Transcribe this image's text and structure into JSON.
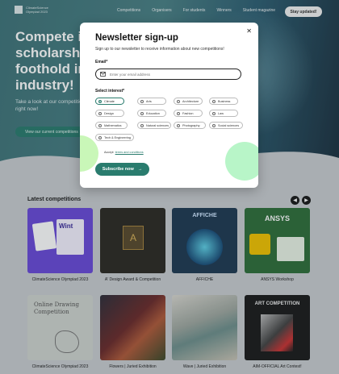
{
  "nav": {
    "logo_text": "ClimateScience Olympiad 2023",
    "links": [
      "Competitions",
      "Organisers",
      "For students",
      "Winners",
      "Student magazine"
    ],
    "stay_label": "Stay updated!"
  },
  "hero": {
    "title": "Compete in scholarships foothold in industry!",
    "subtitle": "Take a look at our competitions available right now!",
    "cta": "View our current competitions"
  },
  "competitions": {
    "heading": "Latest competitions",
    "cards": [
      {
        "title": "ClimateScience Olympiad 2023",
        "poster": "Wint",
        "color": "#6a4ad8"
      },
      {
        "title": "A' Design Award & Competition",
        "poster": "A",
        "color": "#2d2a24"
      },
      {
        "title": "AFFICHE",
        "poster": "AFFICHE",
        "color": "#1f3a52"
      },
      {
        "title": "ANSYS Workshop",
        "poster": "ANSYS",
        "color": "#2f6e3a"
      },
      {
        "title": "ClimateScience Olympiad 2023",
        "poster": "Online Drawing Competition",
        "color": "#cfd3cf"
      },
      {
        "title": "Flowers | Juried Exhibition",
        "poster": "",
        "color": "#4a3c3c"
      },
      {
        "title": "Wave | Juried Exhibition",
        "poster": "",
        "color": "#b7b7b2"
      },
      {
        "title": "AIM-OFFICIAL Art Contest!",
        "poster": "ART COMPETITION",
        "color": "#1c1c1c"
      }
    ]
  },
  "modal": {
    "title": "Newsletter sign-up",
    "subtitle": "Sign up to our newsletter to receive information about new competitions!",
    "email_label": "Email*",
    "email_placeholder": "Enter your email address",
    "interest_label": "Select interest*",
    "interests": [
      {
        "label": "Climate",
        "selected": true
      },
      {
        "label": "Arts",
        "selected": false
      },
      {
        "label": "Architecture",
        "selected": false
      },
      {
        "label": "Business",
        "selected": false
      },
      {
        "label": "Design",
        "selected": false
      },
      {
        "label": "Education",
        "selected": false
      },
      {
        "label": "Fashion",
        "selected": false
      },
      {
        "label": "Law",
        "selected": false
      },
      {
        "label": "Mathematics",
        "selected": false
      },
      {
        "label": "Natural sciences",
        "selected": false
      },
      {
        "label": "Photography",
        "selected": false
      },
      {
        "label": "Social sciences",
        "selected": false
      },
      {
        "label": "Tech & Engineering",
        "selected": false
      }
    ],
    "accept_prefix": "Accept",
    "accept_link": "terms and conditions",
    "subscribe_label": "Subscribe now",
    "accent": "#2a7c6e",
    "blob_color": "#b8f5c8"
  }
}
